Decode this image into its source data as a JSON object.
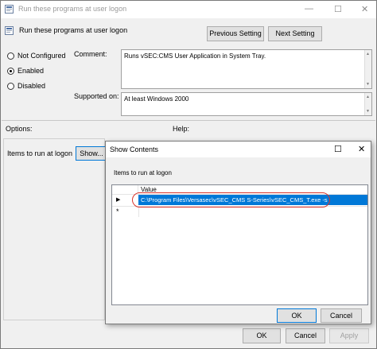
{
  "window": {
    "title": "Run these programs at user logon",
    "setting_title": "Run these programs at user logon",
    "controls": {
      "minimize": "—",
      "maximize": "☐",
      "close": "✕"
    }
  },
  "nav": {
    "previous_label": "Previous Setting",
    "next_label": "Next Setting"
  },
  "state": {
    "options": [
      "Not Configured",
      "Enabled",
      "Disabled"
    ],
    "selected": "Enabled"
  },
  "comment": {
    "label": "Comment:",
    "value": "Runs vSEC:CMS User Application in System Tray."
  },
  "supported": {
    "label": "Supported on:",
    "value": "At least Windows 2000"
  },
  "options_label": "Options:",
  "help_label": "Help:",
  "run_at_logon": {
    "label": "Items to run at logon",
    "show_button": "Show..."
  },
  "dialog": {
    "title": "Show Contents",
    "list_label": "Items to run at logon",
    "column_header": "Value",
    "rows": [
      {
        "marker": "▶",
        "value": "C:\\Program Files\\Versasec\\vSEC_CMS S-Series\\vSEC_CMS_T.exe -s",
        "selected": true
      },
      {
        "marker": "*",
        "value": "",
        "selected": false
      }
    ],
    "ok_label": "OK",
    "cancel_label": "Cancel",
    "controls": {
      "maximize": "☐",
      "close": "✕"
    }
  },
  "footer": {
    "ok_label": "OK",
    "cancel_label": "Cancel",
    "apply_label": "Apply"
  },
  "colors": {
    "selection": "#0078d7",
    "highlight_circle": "#d9342b"
  }
}
